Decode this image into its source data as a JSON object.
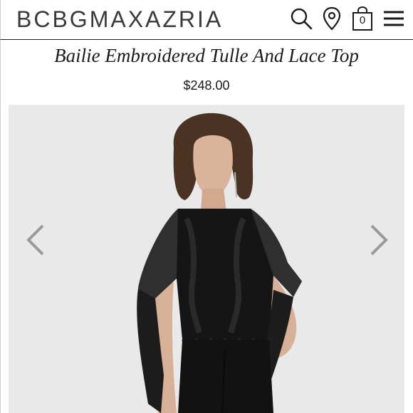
{
  "header": {
    "brand": "BCBGMAXAZRIA",
    "icons": [
      "search-icon",
      "location-pin-icon",
      "shopping-bag-icon",
      "menu-icon"
    ],
    "bag_count": "0"
  },
  "product": {
    "title": "Bailie Embroidered Tulle And Lace Top",
    "price": "$248.00"
  },
  "gallery": {
    "prev_icon": "chevron-left-icon",
    "next_icon": "chevron-right-icon",
    "colors": {
      "background": "#e9e9e9",
      "garment": "#141414",
      "arrow": "#9a9a9a"
    }
  }
}
